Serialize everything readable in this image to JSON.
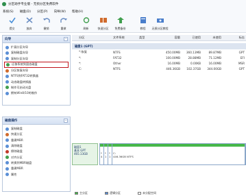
{
  "window": {
    "title": "分区助手专业版 - 无损分区免费软件"
  },
  "menu": [
    "系统(S)",
    "磁盘(D)",
    "分区(P)",
    "向导(W)",
    "帮助(H)"
  ],
  "toolbar": [
    {
      "label": "提交",
      "icon": "submit-icon",
      "color": "#4a90d9"
    },
    {
      "label": "放弃",
      "icon": "discard-icon",
      "color": "#6c8fc4"
    },
    {
      "label": "撤销",
      "icon": "undo-icon",
      "color": "#6c8fc4"
    },
    {
      "label": "重做",
      "icon": "redo-icon",
      "color": "#6c8fc4"
    },
    {
      "label": "刷新",
      "icon": "refresh-icon",
      "color": "#3f9e4d"
    },
    {
      "label": "快速分区",
      "icon": "quick-partition-icon",
      "color": "#d06b2d"
    },
    {
      "label": "免费备份",
      "icon": "backup-icon",
      "color": "#3f9e4d"
    },
    {
      "label": "教程",
      "icon": "tutorial-icon",
      "color": "#4a7ecb"
    },
    {
      "label": "无损分区教程",
      "icon": "lossless-tutorial-icon",
      "color": "#4a7ecb"
    }
  ],
  "wizard_panel": {
    "title": "向导",
    "collapse": "−",
    "items": [
      {
        "label": "扩展分区向导",
        "color": "#5b8fd6"
      },
      {
        "label": "复制磁盘向导",
        "color": "#5b8fd6"
      },
      {
        "label": "复制分区向导",
        "color": "#5b8fd6"
      },
      {
        "label": "迁移系统到固态磁盘",
        "color": "#3f9e4d",
        "highlight": true
      },
      {
        "label": "分区恢复向导",
        "color": "#d06b2d"
      },
      {
        "label": "NTFS到FAT32转换器",
        "color": "#5b8fd6"
      },
      {
        "label": "动态磁盘转换器",
        "color": "#5b8fd6"
      },
      {
        "label": "制作可启动光盘",
        "color": "#3f9e4d"
      },
      {
        "label": "拥有Win8/10的制作",
        "color": "#5b8fd6"
      }
    ]
  },
  "disk_panel": {
    "title": "磁盘操作",
    "collapse": "−",
    "items": [
      {
        "label": "复制磁盘",
        "color": "#5b8fd6"
      },
      {
        "label": "快速分区",
        "color": "#d06b2d"
      },
      {
        "label": "重建MBR",
        "color": "#5b8fd6"
      },
      {
        "label": "清除磁盘",
        "color": "#5b8fd6"
      },
      {
        "label": "擦除磁盘",
        "color": "#c0392b"
      },
      {
        "label": "对齐分区",
        "color": "#3f9e4d"
      },
      {
        "label": "转换到MBR磁盘",
        "color": "#5b8fd6"
      },
      {
        "label": "重建MBR",
        "color": "#5b8fd6"
      },
      {
        "label": "属性",
        "color": "#5b8fd6"
      }
    ]
  },
  "table": {
    "headers": [
      "分区",
      "文件系统",
      "类型",
      "容量",
      "已使用",
      "未使用",
      "标志"
    ],
    "disk_label": "磁盘1 (GPT)",
    "rows": [
      {
        "name": "*:恢复",
        "fs": "NTFS",
        "type": "",
        "capacity": "450.00MB",
        "used": "360.13MB",
        "free": "89.87MB",
        "flag": "GPT"
      },
      {
        "name": "*:",
        "fs": "FAT32",
        "type": "",
        "capacity": "100.00MB",
        "used": "28.88MB",
        "free": "71.12MB",
        "flag": "EFI"
      },
      {
        "name": "*:",
        "fs": "Other",
        "type": "",
        "capacity": "16.00MB",
        "used": "0.00KB",
        "free": "16.00MB",
        "flag": "MSR"
      },
      {
        "name": "C:",
        "fs": "NTFS",
        "type": "",
        "capacity": "446.36GB",
        "used": "102.37GB",
        "free": "344.00GB",
        "flag": "GPT"
      }
    ]
  },
  "diskmap": {
    "info": [
      "磁盘1",
      "基本 GPT",
      "465.13GB"
    ],
    "segments": [
      {
        "label": "*",
        "size": "4",
        "fraction": 0.02
      },
      {
        "label": "*",
        "size": "1",
        "fraction": 0.015
      },
      {
        "label": "*",
        "size": "1",
        "fraction": 0.015
      },
      {
        "label": "C:",
        "size": "446.36GB NTFS",
        "fraction": 0.95
      }
    ],
    "bar_color": "#47b84a"
  },
  "legend": [
    {
      "label": "主分区",
      "color": "#47b84a"
    },
    {
      "label": "逻辑分区",
      "color": "#5b8fd6"
    },
    {
      "label": "未分配空间",
      "color": "#ffffff"
    }
  ]
}
